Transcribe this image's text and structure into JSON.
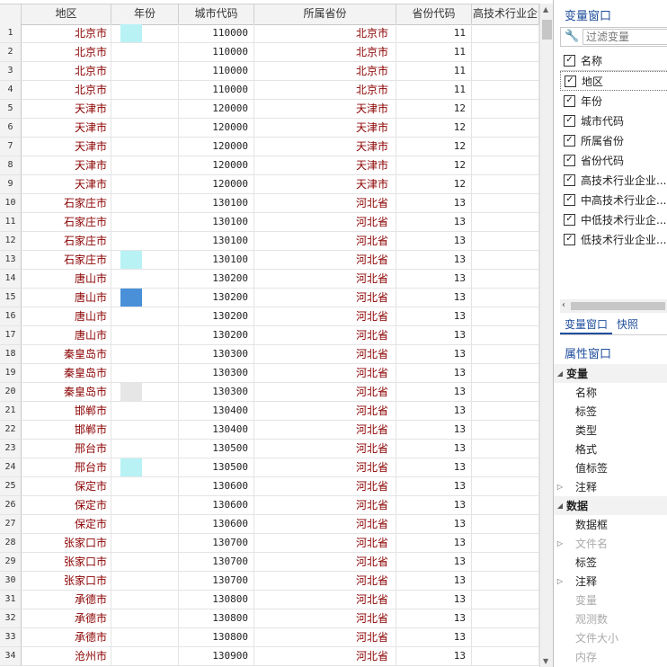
{
  "grid": {
    "columns": [
      "",
      "地区",
      "年份",
      "城市代码",
      "所属省份",
      "省份代码",
      "高技术行业企"
    ],
    "rows": [
      {
        "n": "1",
        "region": "北京市",
        "year_color": "#b8f2f5",
        "city_code": "110000",
        "province": "北京市",
        "prov_code": "11"
      },
      {
        "n": "2",
        "region": "北京市",
        "year_color": "",
        "city_code": "110000",
        "province": "北京市",
        "prov_code": "11"
      },
      {
        "n": "3",
        "region": "北京市",
        "year_color": "",
        "city_code": "110000",
        "province": "北京市",
        "prov_code": "11"
      },
      {
        "n": "4",
        "region": "北京市",
        "year_color": "",
        "city_code": "110000",
        "province": "北京市",
        "prov_code": "11"
      },
      {
        "n": "5",
        "region": "天津市",
        "year_color": "",
        "city_code": "120000",
        "province": "天津市",
        "prov_code": "12"
      },
      {
        "n": "6",
        "region": "天津市",
        "year_color": "",
        "city_code": "120000",
        "province": "天津市",
        "prov_code": "12"
      },
      {
        "n": "7",
        "region": "天津市",
        "year_color": "",
        "city_code": "120000",
        "province": "天津市",
        "prov_code": "12"
      },
      {
        "n": "8",
        "region": "天津市",
        "year_color": "",
        "city_code": "120000",
        "province": "天津市",
        "prov_code": "12"
      },
      {
        "n": "9",
        "region": "天津市",
        "year_color": "",
        "city_code": "120000",
        "province": "天津市",
        "prov_code": "12"
      },
      {
        "n": "10",
        "region": "石家庄市",
        "year_color": "",
        "city_code": "130100",
        "province": "河北省",
        "prov_code": "13"
      },
      {
        "n": "11",
        "region": "石家庄市",
        "year_color": "",
        "city_code": "130100",
        "province": "河北省",
        "prov_code": "13"
      },
      {
        "n": "12",
        "region": "石家庄市",
        "year_color": "",
        "city_code": "130100",
        "province": "河北省",
        "prov_code": "13"
      },
      {
        "n": "13",
        "region": "石家庄市",
        "year_color": "#b8f2f5",
        "city_code": "130100",
        "province": "河北省",
        "prov_code": "13"
      },
      {
        "n": "14",
        "region": "唐山市",
        "year_color": "",
        "city_code": "130200",
        "province": "河北省",
        "prov_code": "13"
      },
      {
        "n": "15",
        "region": "唐山市",
        "year_color": "#4a90d9",
        "city_code": "130200",
        "province": "河北省",
        "prov_code": "13"
      },
      {
        "n": "16",
        "region": "唐山市",
        "year_color": "",
        "city_code": "130200",
        "province": "河北省",
        "prov_code": "13"
      },
      {
        "n": "17",
        "region": "唐山市",
        "year_color": "",
        "city_code": "130200",
        "province": "河北省",
        "prov_code": "13"
      },
      {
        "n": "18",
        "region": "秦皇岛市",
        "year_color": "",
        "city_code": "130300",
        "province": "河北省",
        "prov_code": "13"
      },
      {
        "n": "19",
        "region": "秦皇岛市",
        "year_color": "",
        "city_code": "130300",
        "province": "河北省",
        "prov_code": "13"
      },
      {
        "n": "20",
        "region": "秦皇岛市",
        "year_color": "#e6e6e6",
        "city_code": "130300",
        "province": "河北省",
        "prov_code": "13"
      },
      {
        "n": "21",
        "region": "邯郸市",
        "year_color": "",
        "city_code": "130400",
        "province": "河北省",
        "prov_code": "13"
      },
      {
        "n": "22",
        "region": "邯郸市",
        "year_color": "",
        "city_code": "130400",
        "province": "河北省",
        "prov_code": "13"
      },
      {
        "n": "23",
        "region": "邢台市",
        "year_color": "",
        "city_code": "130500",
        "province": "河北省",
        "prov_code": "13"
      },
      {
        "n": "24",
        "region": "邢台市",
        "year_color": "#b8f2f5",
        "city_code": "130500",
        "province": "河北省",
        "prov_code": "13"
      },
      {
        "n": "25",
        "region": "保定市",
        "year_color": "",
        "city_code": "130600",
        "province": "河北省",
        "prov_code": "13"
      },
      {
        "n": "26",
        "region": "保定市",
        "year_color": "",
        "city_code": "130600",
        "province": "河北省",
        "prov_code": "13"
      },
      {
        "n": "27",
        "region": "保定市",
        "year_color": "",
        "city_code": "130600",
        "province": "河北省",
        "prov_code": "13"
      },
      {
        "n": "28",
        "region": "张家口市",
        "year_color": "",
        "city_code": "130700",
        "province": "河北省",
        "prov_code": "13"
      },
      {
        "n": "29",
        "region": "张家口市",
        "year_color": "",
        "city_code": "130700",
        "province": "河北省",
        "prov_code": "13"
      },
      {
        "n": "30",
        "region": "张家口市",
        "year_color": "",
        "city_code": "130700",
        "province": "河北省",
        "prov_code": "13"
      },
      {
        "n": "31",
        "region": "承德市",
        "year_color": "",
        "city_code": "130800",
        "province": "河北省",
        "prov_code": "13"
      },
      {
        "n": "32",
        "region": "承德市",
        "year_color": "",
        "city_code": "130800",
        "province": "河北省",
        "prov_code": "13"
      },
      {
        "n": "33",
        "region": "承德市",
        "year_color": "",
        "city_code": "130800",
        "province": "河北省",
        "prov_code": "13"
      },
      {
        "n": "34",
        "region": "沧州市",
        "year_color": "",
        "city_code": "130900",
        "province": "河北省",
        "prov_code": "13"
      }
    ]
  },
  "variable_window": {
    "title": "变量窗口",
    "filter_placeholder": "过滤变量",
    "header_label": "名称",
    "items": [
      "地区",
      "年份",
      "城市代码",
      "所属省份",
      "省份代码",
      "高技术行业企业...",
      "中高技术行业企...",
      "中低技术行业企...",
      "低技术行业企业..."
    ],
    "selected_index": 0
  },
  "tabs": [
    "变量窗口",
    "快照"
  ],
  "property_window": {
    "title": "属性窗口",
    "rows": [
      {
        "label": "变量",
        "kind": "group",
        "tri": "◢"
      },
      {
        "label": "名称",
        "kind": "item",
        "tri": ""
      },
      {
        "label": "标签",
        "kind": "item",
        "tri": ""
      },
      {
        "label": "类型",
        "kind": "item",
        "tri": ""
      },
      {
        "label": "格式",
        "kind": "item",
        "tri": ""
      },
      {
        "label": "值标签",
        "kind": "item",
        "tri": ""
      },
      {
        "label": "注释",
        "kind": "item",
        "tri": "▷"
      },
      {
        "label": "数据",
        "kind": "group",
        "tri": "◢"
      },
      {
        "label": "数据框",
        "kind": "item",
        "tri": ""
      },
      {
        "label": "文件名",
        "kind": "disabled",
        "tri": "▷"
      },
      {
        "label": "标签",
        "kind": "item",
        "tri": ""
      },
      {
        "label": "注释",
        "kind": "item",
        "tri": "▷"
      },
      {
        "label": "变量",
        "kind": "disabled",
        "tri": ""
      },
      {
        "label": "观测数",
        "kind": "disabled",
        "tri": ""
      },
      {
        "label": "文件大小",
        "kind": "disabled",
        "tri": ""
      },
      {
        "label": "内存",
        "kind": "disabled",
        "tri": ""
      }
    ]
  },
  "colors": {
    "region_text": "#8b0000",
    "accent": "#1f4e9c"
  }
}
